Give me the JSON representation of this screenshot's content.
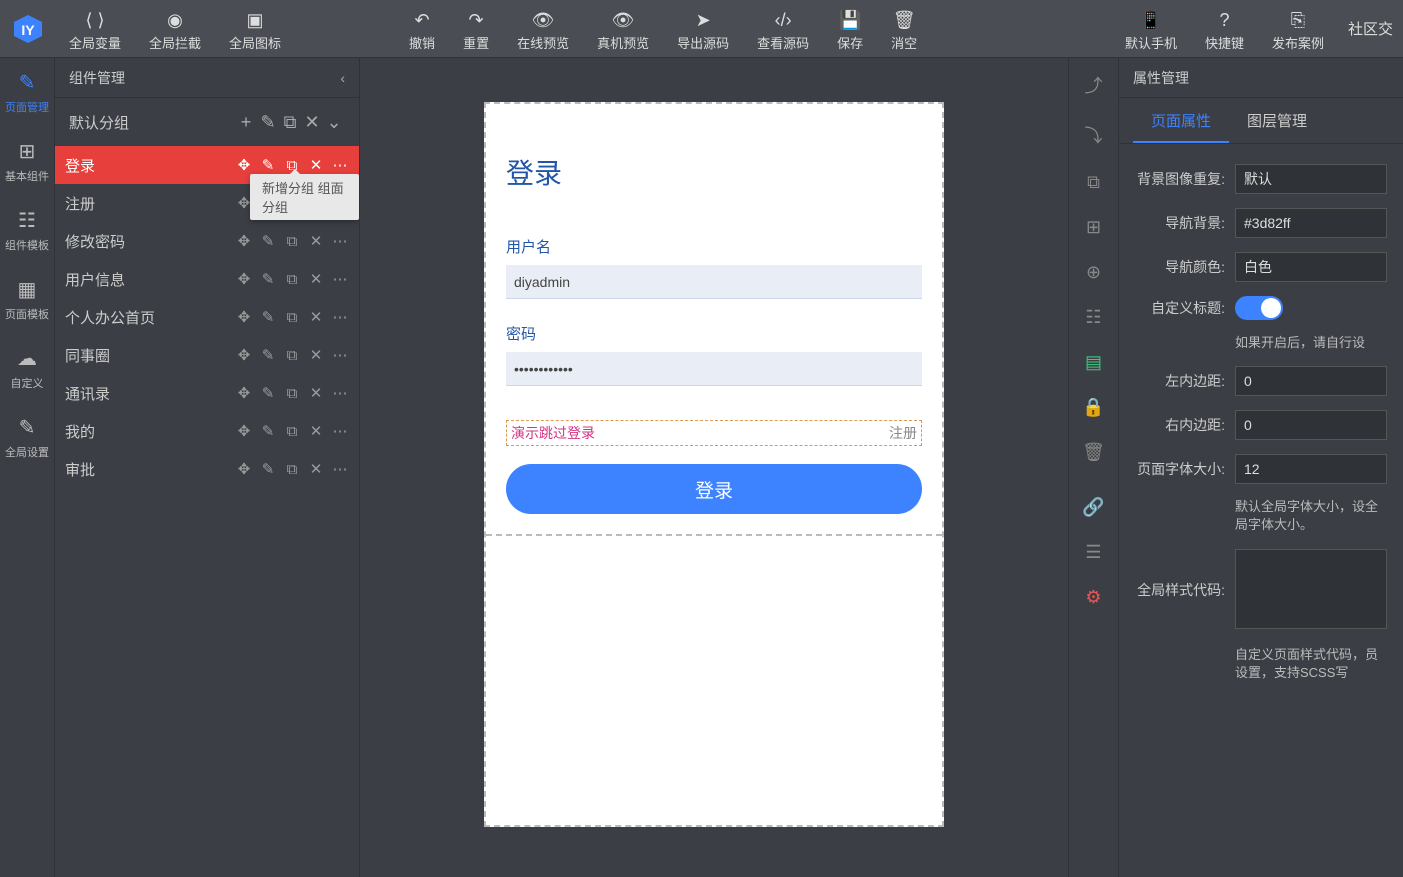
{
  "topbar": {
    "left": [
      {
        "label": "全局变量",
        "icon": "var"
      },
      {
        "label": "全局拦截",
        "icon": "shield"
      },
      {
        "label": "全局图标",
        "icon": "ad"
      }
    ],
    "center": [
      {
        "label": "撤销",
        "icon": "undo"
      },
      {
        "label": "重置",
        "icon": "redo"
      },
      {
        "label": "在线预览",
        "icon": "eye"
      },
      {
        "label": "真机预览",
        "icon": "eye"
      },
      {
        "label": "导出源码",
        "icon": "send"
      },
      {
        "label": "查看源码",
        "icon": "code"
      },
      {
        "label": "保存",
        "icon": "save"
      },
      {
        "label": "消空",
        "icon": "trash"
      }
    ],
    "right": [
      {
        "label": "默认手机",
        "icon": "phone"
      },
      {
        "label": "快捷键",
        "icon": "help"
      },
      {
        "label": "发布案例",
        "icon": "publish"
      }
    ],
    "community": "社区交"
  },
  "leftRail": [
    {
      "label": "页面管理",
      "icon": "✎",
      "active": true
    },
    {
      "label": "基本组件",
      "icon": "⊞"
    },
    {
      "label": "组件模板",
      "icon": "☷"
    },
    {
      "label": "页面模板",
      "icon": "▦"
    },
    {
      "label": "自定义",
      "icon": "☁"
    },
    {
      "label": "全局设置",
      "icon": "✎"
    }
  ],
  "leftPanel": {
    "title": "组件管理",
    "groupName": "默认分组",
    "tooltip": "新增分组   组面分组",
    "pages": [
      {
        "label": "登录",
        "active": true
      },
      {
        "label": "注册"
      },
      {
        "label": "修改密码"
      },
      {
        "label": "用户信息"
      },
      {
        "label": "个人办公首页"
      },
      {
        "label": "同事圈"
      },
      {
        "label": "通讯录"
      },
      {
        "label": "我的"
      },
      {
        "label": "审批"
      }
    ]
  },
  "canvas": {
    "title": "登录",
    "usernameLabel": "用户名",
    "usernameValue": "diyadmin",
    "passwordLabel": "密码",
    "passwordValue": "••••••••••••",
    "skipText": "演示跳过登录",
    "registerText": "注册",
    "loginButton": "登录"
  },
  "propPanel": {
    "title": "属性管理",
    "tabs": [
      {
        "label": "页面属性",
        "active": true
      },
      {
        "label": "图层管理"
      }
    ],
    "rows": {
      "bgRepeat": {
        "label": "背景图像重复:",
        "value": "默认"
      },
      "navBg": {
        "label": "导航背景:",
        "value": "#3d82ff"
      },
      "navColor": {
        "label": "导航颜色:",
        "value": "白色"
      },
      "customTitle": {
        "label": "自定义标题:",
        "value": true
      },
      "customTitleHint": "如果开启后，请自行设",
      "paddingLeft": {
        "label": "左内边距:",
        "value": "0"
      },
      "paddingRight": {
        "label": "右内边距:",
        "value": "0"
      },
      "fontSize": {
        "label": "页面字体大小:",
        "value": "12"
      },
      "fontSizeHint": "默认全局字体大小，设全局字体大小。",
      "globalStyle": {
        "label": "全局样式代码:",
        "value": ""
      },
      "globalHint": "自定义页面样式代码，员设置，支持SCSS写"
    }
  }
}
